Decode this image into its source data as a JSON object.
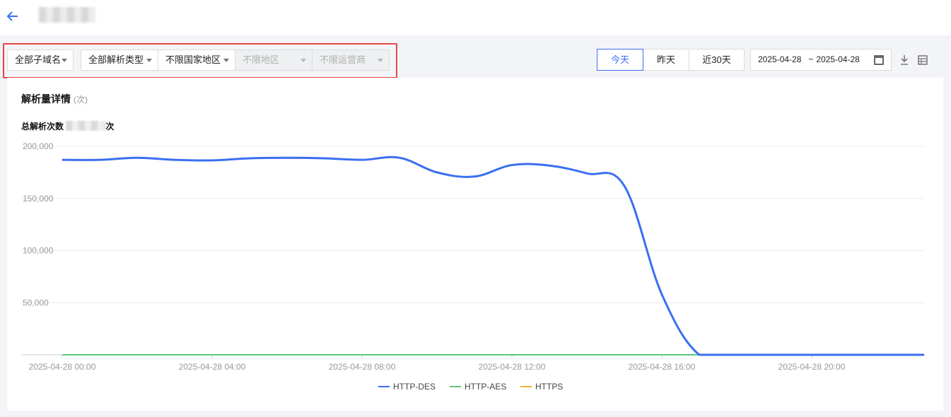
{
  "header": {
    "back_icon": "arrow-left-icon"
  },
  "filters": {
    "subdomain": "全部子域名",
    "record_type": "全部解析类型",
    "country": "不限国家地区",
    "region": "不限地区",
    "isp": "不限运营商"
  },
  "time_range": {
    "today": "今天",
    "yesterday": "昨天",
    "last30": "近30天",
    "start": "2025-04-28",
    "sep": "~",
    "end": "2025-04-28"
  },
  "card": {
    "title": "解析量详情",
    "unit": "(次)",
    "total_label": "总解析次数",
    "total_unit": "次"
  },
  "colors": {
    "accent": "#3a6ff0",
    "highlight_border": "#e54545"
  },
  "chart_data": {
    "type": "line",
    "x_labels": [
      "2025-04-28 00:00",
      "2025-04-28 04:00",
      "2025-04-28 08:00",
      "2025-04-28 12:00",
      "2025-04-28 16:00",
      "2025-04-28 20:00"
    ],
    "x_hours": [
      0,
      1,
      2,
      3,
      4,
      5,
      6,
      7,
      8,
      9,
      10,
      11,
      12,
      13,
      14,
      15,
      16,
      17,
      18,
      19,
      20,
      21,
      22,
      23
    ],
    "yticks": [
      50000,
      100000,
      150000,
      200000
    ],
    "ytick_labels": [
      "50,000",
      "100,000",
      "150,000",
      "200,000"
    ],
    "ylim": [
      0,
      200000
    ],
    "series": [
      {
        "name": "HTTP-DES",
        "color": "#3a6ff0",
        "values": [
          187000,
          187000,
          189000,
          187000,
          186500,
          188500,
          189000,
          188500,
          187000,
          189000,
          175000,
          171000,
          182000,
          181500,
          174000,
          162000,
          58000,
          0,
          0,
          0,
          0,
          0,
          0,
          0
        ]
      },
      {
        "name": "HTTP-AES",
        "color": "#5cc87a",
        "values": [
          0,
          0,
          0,
          0,
          0,
          0,
          0,
          0,
          0,
          0,
          0,
          0,
          0,
          0,
          0,
          0,
          0,
          0,
          0,
          0,
          0,
          0,
          0,
          0
        ]
      },
      {
        "name": "HTTPS",
        "color": "#f5b335",
        "values": [
          0,
          0,
          0,
          0,
          0,
          0,
          0,
          0,
          0,
          0,
          0,
          0,
          0,
          0,
          0,
          0,
          0,
          0,
          0,
          0,
          0,
          0,
          0,
          0
        ]
      }
    ],
    "grid": true,
    "legend": "bottom-center"
  }
}
